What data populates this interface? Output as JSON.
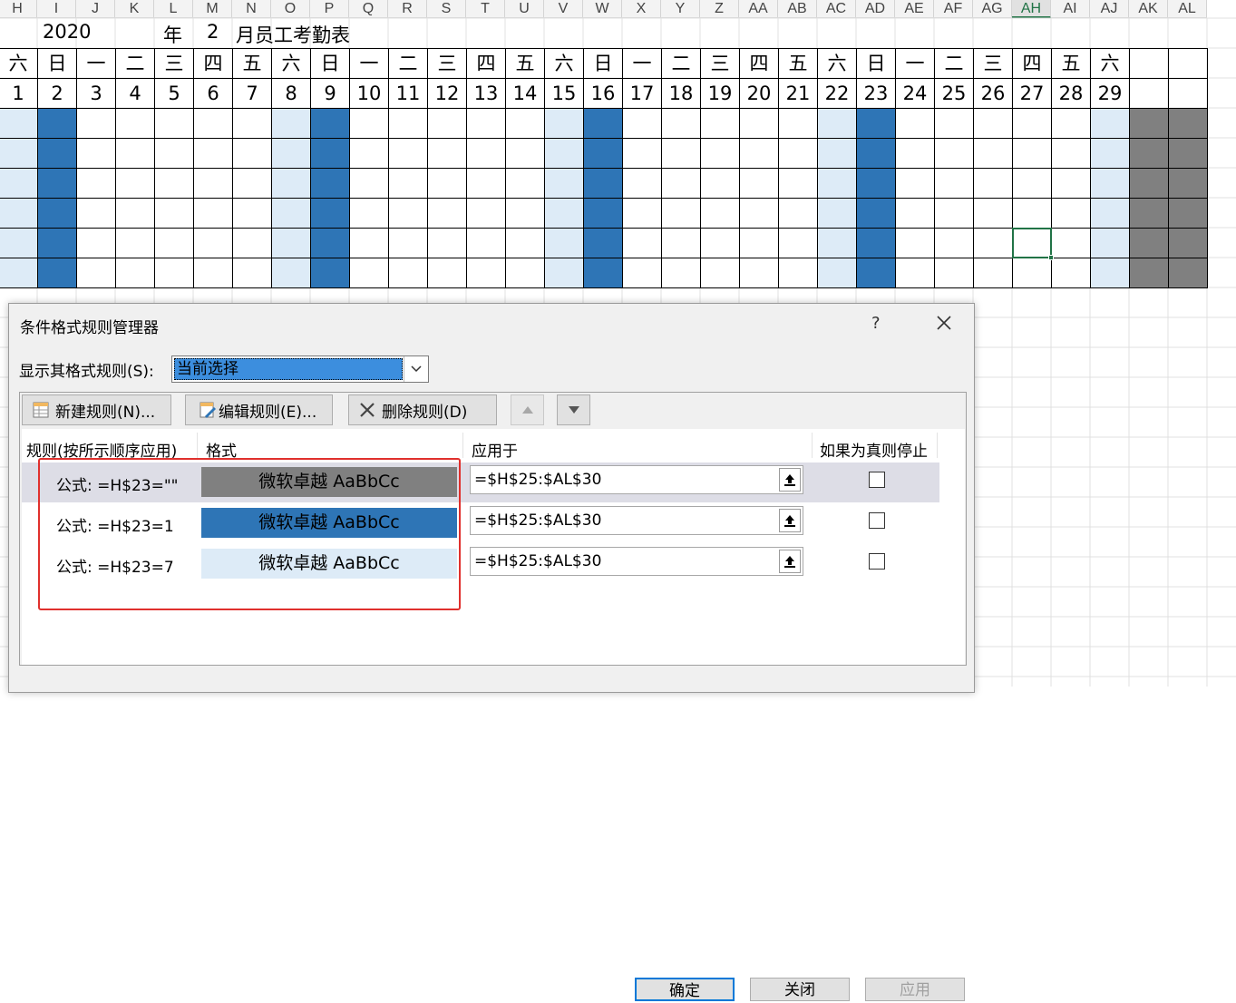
{
  "spreadsheet": {
    "columns": [
      "H",
      "I",
      "J",
      "K",
      "L",
      "M",
      "N",
      "O",
      "P",
      "Q",
      "R",
      "S",
      "T",
      "U",
      "V",
      "W",
      "X",
      "Y",
      "Z",
      "AA",
      "AB",
      "AC",
      "AD",
      "AE",
      "AF",
      "AG",
      "AH",
      "AI",
      "AJ",
      "AK",
      "AL"
    ],
    "selected_column": "AH",
    "title": {
      "year": "2020",
      "year_unit": "年",
      "month": "2",
      "suffix": "月员工考勤表"
    },
    "weekdays": [
      "六",
      "日",
      "一",
      "二",
      "三",
      "四",
      "五",
      "六",
      "日",
      "一",
      "二",
      "三",
      "四",
      "五",
      "六",
      "日",
      "一",
      "二",
      "三",
      "四",
      "五",
      "六",
      "日",
      "一",
      "二",
      "三",
      "四",
      "五",
      "六",
      "",
      ""
    ],
    "dates": [
      "1",
      "2",
      "3",
      "4",
      "5",
      "6",
      "7",
      "8",
      "9",
      "10",
      "11",
      "12",
      "13",
      "14",
      "15",
      "16",
      "17",
      "18",
      "19",
      "20",
      "21",
      "22",
      "23",
      "24",
      "25",
      "26",
      "27",
      "28",
      "29",
      "",
      ""
    ],
    "colors": {
      "saturday_fill": "#ddebf7",
      "sunday_fill": "#2e75b6",
      "blank_fill": "#808080",
      "selected_border": "#217346"
    }
  },
  "dialog": {
    "title": "条件格式规则管理器",
    "help": "?",
    "show_rules_label": "显示其格式规则(S):",
    "scope_value": "当前选择",
    "buttons": {
      "new_rule": "新建规则(N)...",
      "edit_rule": "编辑规则(E)...",
      "delete_rule": "删除规则(D)"
    },
    "columns": {
      "rule": "规则(按所示顺序应用)",
      "format": "格式",
      "applies_to": "应用于",
      "stop_if_true": "如果为真则停止"
    },
    "rules": [
      {
        "label": "公式: =H$23=\"\"",
        "preview": "微软卓越  AaBbCc",
        "fill": "#808080",
        "applies_to": "=$H$25:$AL$30",
        "stop": false
      },
      {
        "label": "公式: =H$23=1",
        "preview": "微软卓越  AaBbCc",
        "fill": "#2e75b6",
        "applies_to": "=$H$25:$AL$30",
        "stop": false
      },
      {
        "label": "公式: =H$23=7",
        "preview": "微软卓越  AaBbCc",
        "fill": "#ddebf7",
        "applies_to": "=$H$25:$AL$30",
        "stop": false
      }
    ],
    "footer": {
      "ok": "确定",
      "cancel": "关闭",
      "apply": "应用"
    },
    "highlight_color": "#e0302d"
  }
}
